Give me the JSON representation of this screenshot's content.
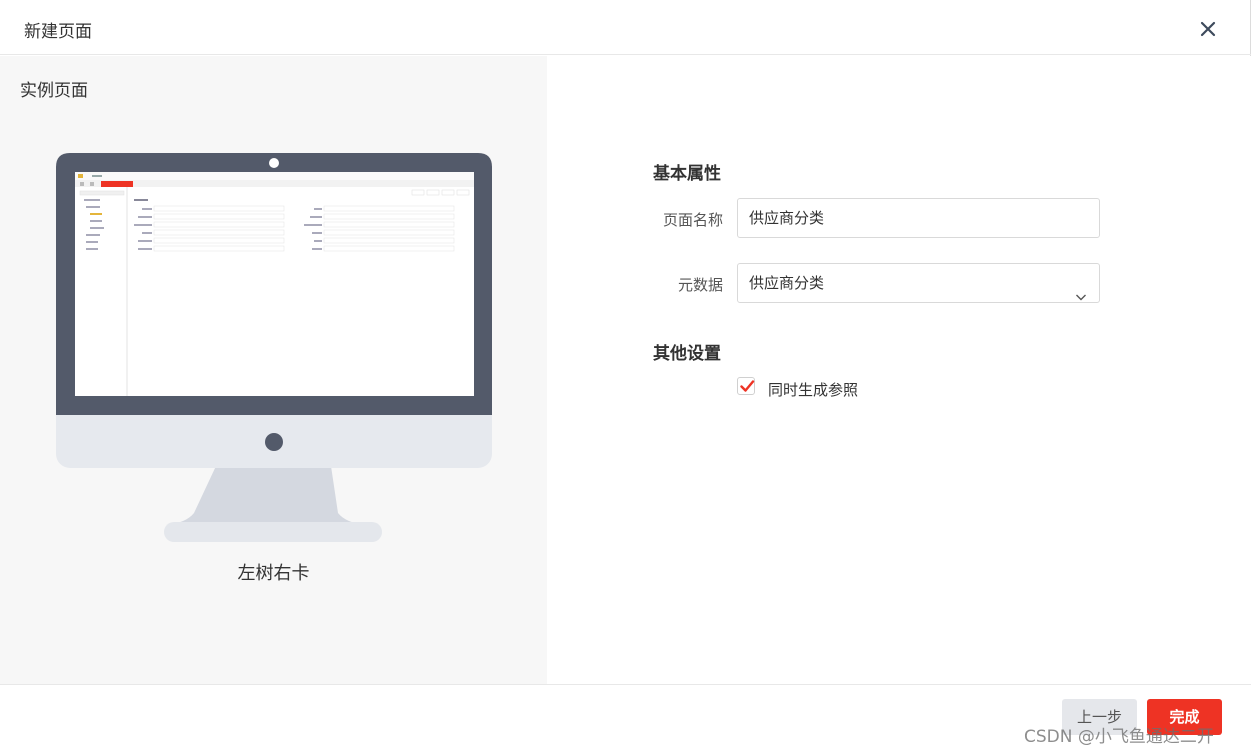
{
  "dialog": {
    "title": "新建页面",
    "close_icon": "close-icon"
  },
  "preview": {
    "title": "实例页面",
    "layout_name": "左树右卡"
  },
  "form": {
    "basic_section": "基本属性",
    "page_name_label": "页面名称",
    "page_name_value": "供应商分类",
    "metadata_label": "元数据",
    "metadata_value": "供应商分类",
    "other_section": "其他设置",
    "generate_ref_label": "同时生成参照",
    "generate_ref_checked": true
  },
  "footer": {
    "prev_label": "上一步",
    "done_label": "完成"
  },
  "watermark": "CSDN @小飞鱼通达二开",
  "colors": {
    "accent": "#ee3324",
    "monitor_frame": "#535a6a",
    "monitor_base": "#e6e9ee"
  }
}
